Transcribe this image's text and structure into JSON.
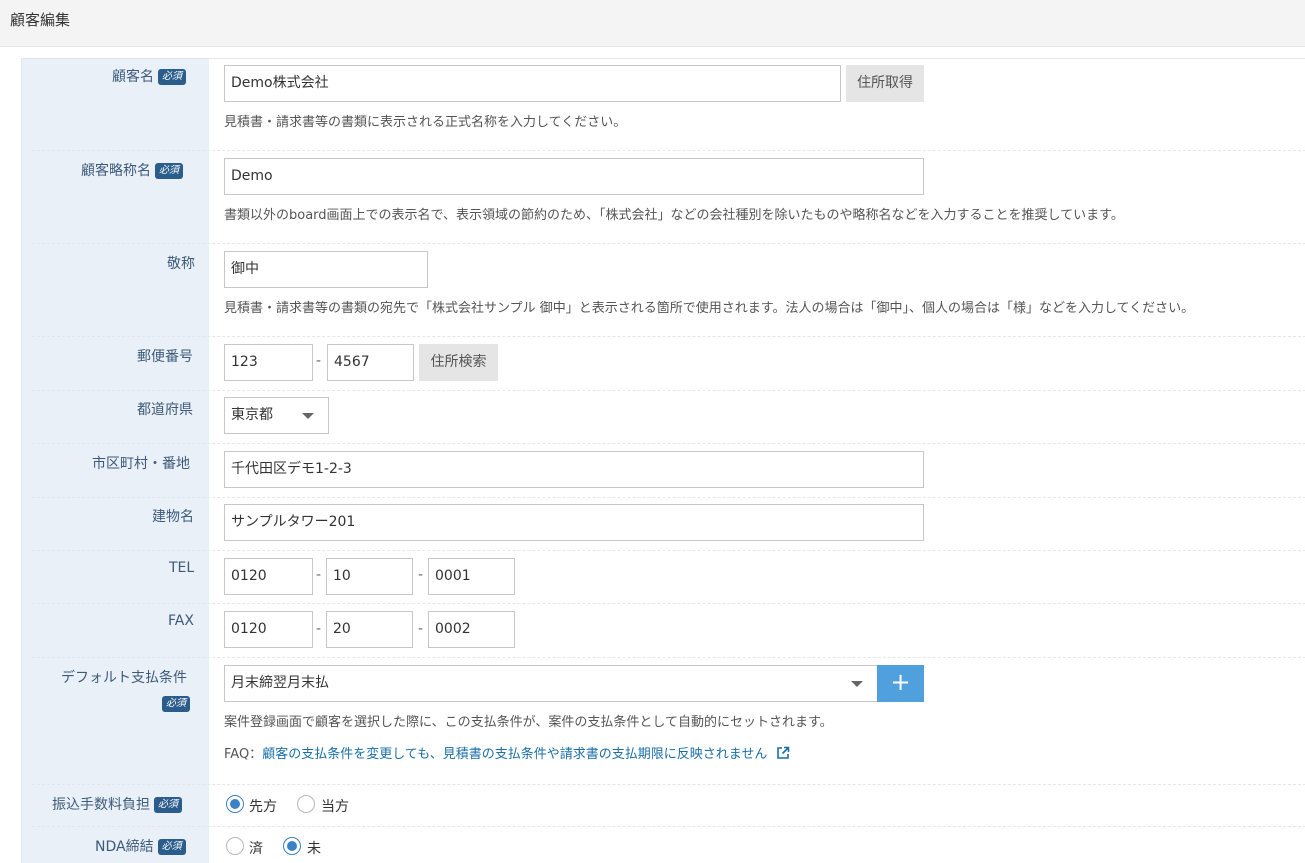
{
  "page": {
    "title": "顧客編集"
  },
  "required_badge": "必須",
  "fields": {
    "customer_name": {
      "label": "顧客名",
      "value": "Demo株式会社",
      "button": "住所取得",
      "help": "見積書・請求書等の書類に表示される正式名称を入力してください。"
    },
    "short_name": {
      "label": "顧客略称名",
      "value": "Demo",
      "help": "書類以外のboard画面上での表示名で、表示領域の節約のため、「株式会社」などの会社種別を除いたものや略称名などを入力することを推奨しています。"
    },
    "honorific": {
      "label": "敬称",
      "value": "御中",
      "help": "見積書・請求書等の書類の宛先で「株式会社サンプル 御中」と表示される箇所で使用されます。法人の場合は「御中」、個人の場合は「様」などを入力してください。"
    },
    "postal": {
      "label": "郵便番号",
      "part1": "123",
      "part2": "4567",
      "separator": "-",
      "button": "住所検索"
    },
    "prefecture": {
      "label": "都道府県",
      "value": "東京都"
    },
    "address": {
      "label": "市区町村・番地",
      "value": "千代田区デモ1-2-3"
    },
    "building": {
      "label": "建物名",
      "value": "サンプルタワー201"
    },
    "tel": {
      "label": "TEL",
      "part1": "0120",
      "part2": "10",
      "part3": "0001"
    },
    "fax": {
      "label": "FAX",
      "part1": "0120",
      "part2": "20",
      "part3": "0002"
    },
    "payment_terms": {
      "label": "デフォルト支払条件",
      "value": "月末締翌月末払",
      "add_button": "+",
      "help": "案件登録画面で顧客を選択した際に、この支払条件が、案件の支払条件として自動的にセットされます。",
      "faq_prefix": "FAQ：",
      "faq_link": "顧客の支払条件を変更しても、見積書の支払条件や請求書の支払期限に反映されません"
    },
    "transfer_fee": {
      "label": "振込手数料負担",
      "options": [
        "先方",
        "当方"
      ],
      "selected": "先方"
    },
    "nda": {
      "label": "NDA締結",
      "options": [
        "済",
        "未"
      ],
      "selected": "未"
    }
  },
  "colors": {
    "label_bg": "#eaf0f7",
    "label_text": "#3d5a7a",
    "badge_bg": "#2a5d8b",
    "accent": "#4fa0dc",
    "link": "#1a6fa8"
  }
}
